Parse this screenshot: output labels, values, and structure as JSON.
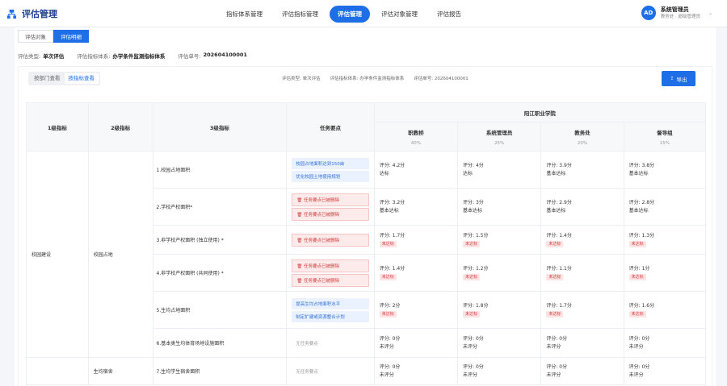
{
  "app": {
    "title": "评估管理"
  },
  "nav": [
    {
      "label": "指标体系管理",
      "active": false
    },
    {
      "label": "评估指标管理",
      "active": false
    },
    {
      "label": "评估管理",
      "active": true
    },
    {
      "label": "评估对象管理",
      "active": false
    },
    {
      "label": "评估报告",
      "active": false
    }
  ],
  "user": {
    "avatar": "AD",
    "name": "系统管理员",
    "role": "教务处 · 超级管理员"
  },
  "tabs": [
    {
      "label": "评估对象",
      "active": false
    },
    {
      "label": "评估明细",
      "active": true
    }
  ],
  "meta": {
    "type_key": "评估类型:",
    "type_val": "单次评估",
    "system_key": "评估指标体系:",
    "system_val": "办学条件监测指标体系",
    "no_key": "评估单号:",
    "no_val": "202604100001"
  },
  "view_toggle": [
    {
      "label": "按部门查看",
      "active": false
    },
    {
      "label": "按指标查看",
      "active": true
    }
  ],
  "meta2": {
    "type": "评估类型: 单次评估",
    "system": "评估指标体系: 办学条件监测指标体系",
    "no": "评估单号: 202604100001"
  },
  "export_label": "导出",
  "table": {
    "headers": {
      "l1": "1级指标",
      "l2": "2级指标",
      "l3": "3级指标",
      "req": "任务要点",
      "school": "阳江职业学院"
    },
    "orgs": [
      {
        "name": "职教桥",
        "pct": "40%"
      },
      {
        "name": "系统管理员",
        "pct": "25%"
      },
      {
        "name": "教务处",
        "pct": "20%"
      },
      {
        "name": "督导组",
        "pct": "15%"
      }
    ],
    "l1": "校园建设",
    "groups": [
      {
        "l2": "校园占地",
        "span": 6
      },
      {
        "l2": "生均宿舍",
        "span": 1
      }
    ],
    "rows": [
      {
        "l3": "1.校园占地面积",
        "reqs": [
          {
            "t": "校园占地面积达到150亩",
            "c": "blue"
          },
          {
            "t": "优化校园土地使用规划",
            "c": "blue"
          }
        ],
        "scores": [
          {
            "s": "评分: 4.2分",
            "r": "达标",
            "fail": false
          },
          {
            "s": "评分: 4分",
            "r": "达标",
            "fail": false
          },
          {
            "s": "评分: 3.9分",
            "r": "基本达标",
            "fail": false
          },
          {
            "s": "评分: 3.8分",
            "r": "基本达标",
            "fail": false
          }
        ]
      },
      {
        "l3": "2.学校产权面积*",
        "reqs": [
          {
            "t": "任务要点已被删除",
            "c": "red"
          },
          {
            "t": "任务要点已被删除",
            "c": "red"
          }
        ],
        "scores": [
          {
            "s": "评分: 3.2分",
            "r": "基本达标",
            "fail": false
          },
          {
            "s": "评分: 3分",
            "r": "基本达标",
            "fail": false
          },
          {
            "s": "评分: 2.9分",
            "r": "基本达标",
            "fail": false
          },
          {
            "s": "评分: 2.8分",
            "r": "基本达标",
            "fail": false
          }
        ]
      },
      {
        "l3": "3.非学校产权面积 (独立使用) *",
        "reqs": [
          {
            "t": "任务要点已被删除",
            "c": "red"
          }
        ],
        "scores": [
          {
            "s": "评分: 1.7分",
            "r": "未达标",
            "fail": true
          },
          {
            "s": "评分: 1.5分",
            "r": "未达标",
            "fail": true
          },
          {
            "s": "评分: 1.4分",
            "r": "未达标",
            "fail": true
          },
          {
            "s": "评分: 1.3分",
            "r": "未达标",
            "fail": true
          }
        ]
      },
      {
        "l3": "4.非学校产权面积 (共同使用) *",
        "reqs": [
          {
            "t": "任务要点已被删除",
            "c": "red"
          },
          {
            "t": "任务要点已被删除",
            "c": "red"
          }
        ],
        "scores": [
          {
            "s": "评分: 1.4分",
            "r": "未达标",
            "fail": true
          },
          {
            "s": "评分: 1.2分",
            "r": "未达标",
            "fail": true
          },
          {
            "s": "评分: 1.1分",
            "r": "未达标",
            "fail": true
          },
          {
            "s": "评分: 1分",
            "r": "未达标",
            "fail": true
          }
        ]
      },
      {
        "l3": "5.生均占地面积",
        "reqs": [
          {
            "t": "提高生均占地面积水平",
            "c": "blue"
          },
          {
            "t": "制定扩建或资源整合计划",
            "c": "blue"
          }
        ],
        "scores": [
          {
            "s": "评分: 2分",
            "r": "未达标",
            "fail": true
          },
          {
            "s": "评分: 1.8分",
            "r": "未达标",
            "fail": true
          },
          {
            "s": "评分: 1.7分",
            "r": "未达标",
            "fail": true
          },
          {
            "s": "评分: 1.6分",
            "r": "未达标",
            "fail": true
          }
        ]
      },
      {
        "l3": "6.基本类生均体育场地设施面积",
        "reqs": [
          {
            "t": "无任务要点",
            "c": "none"
          }
        ],
        "scores": [
          {
            "s": "评分: 0分",
            "r": "未评分",
            "fail": false
          },
          {
            "s": "评分: 0分",
            "r": "未评分",
            "fail": false
          },
          {
            "s": "评分: 0分",
            "r": "未评分",
            "fail": false
          },
          {
            "s": "评分: 0分",
            "r": "未评分",
            "fail": false
          }
        ]
      },
      {
        "l3": "7.生均学生宿舍面积",
        "reqs": [
          {
            "t": "无任务要点",
            "c": "none"
          }
        ],
        "scores": [
          {
            "s": "评分: 0分",
            "r": "未评分",
            "fail": false
          },
          {
            "s": "评分: 0分",
            "r": "未评分",
            "fail": false
          },
          {
            "s": "评分: 0分",
            "r": "未评分",
            "fail": false
          },
          {
            "s": "评分: 0分",
            "r": "未评分",
            "fail": false
          }
        ]
      }
    ]
  },
  "colors": {
    "accent": "#1e6ee8",
    "danger": "#d23a3a"
  },
  "icons": {
    "logo": "org-chart-icon",
    "export": "upload-icon",
    "delete": "trash-icon",
    "user_menu": "chevron-down-icon"
  }
}
